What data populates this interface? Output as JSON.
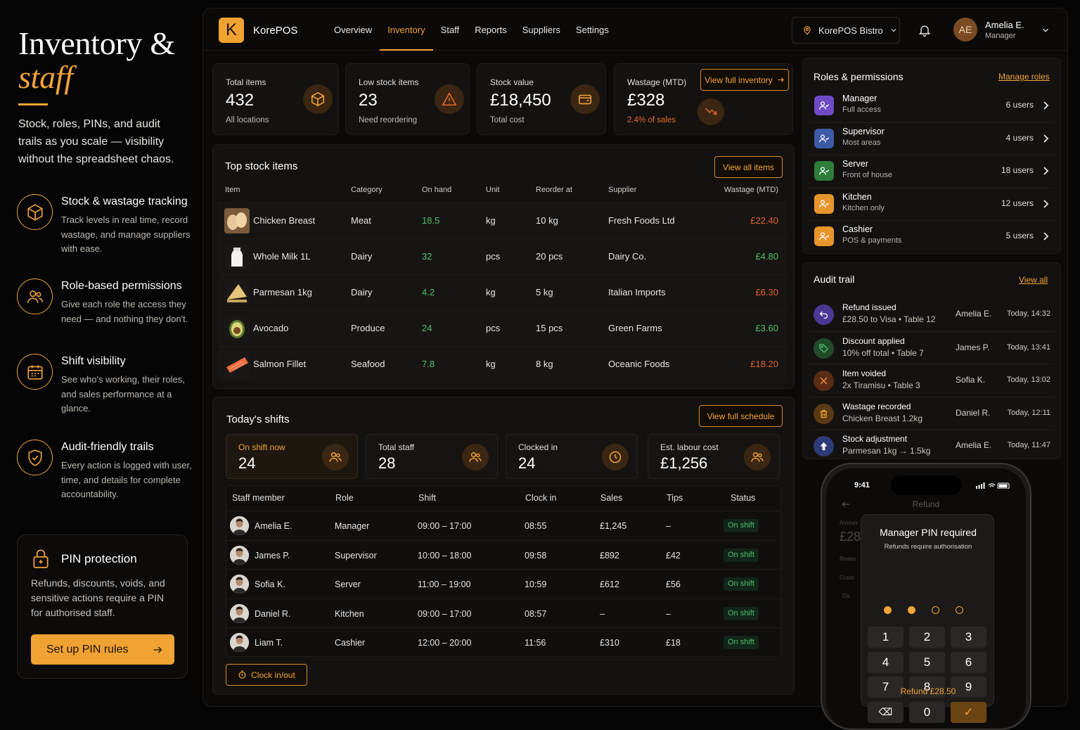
{
  "hero": {
    "title_line1": "Inventory &",
    "title_line2": "staff",
    "subtitle": "Stock, roles, PINs, and audit trails as you scale — visibility without the spreadsheet chaos."
  },
  "features": [
    {
      "icon": "cube-icon",
      "title": "Stock & wastage tracking",
      "desc": "Track levels in real time, record wastage, and manage suppliers with ease."
    },
    {
      "icon": "users-icon",
      "title": "Role-based permissions",
      "desc": "Give each role the access they need — and nothing they don't."
    },
    {
      "icon": "calendar-icon",
      "title": "Shift visibility",
      "desc": "See who's working, their roles, and sales performance at a glance."
    },
    {
      "icon": "shield-check-icon",
      "title": "Audit-friendly trails",
      "desc": "Every action is logged with user, time, and details for complete accountability."
    }
  ],
  "pin_card": {
    "icon": "lock-icon",
    "title": "PIN protection",
    "desc": "Refunds, discounts, voids, and sensitive actions require a PIN for authorised staff.",
    "button": "Set up PIN rules"
  },
  "topbar": {
    "logo_letter": "K",
    "brand": "KorePOS",
    "nav": [
      "Overview",
      "Inventory",
      "Staff",
      "Reports",
      "Suppliers",
      "Settings"
    ],
    "active_nav": "Inventory",
    "location": "KorePOS Bistro",
    "user_initials": "AE",
    "user_name": "Amelia E.",
    "user_role": "Manager"
  },
  "kpis": [
    {
      "label": "Total items",
      "value": "432",
      "sub": "All locations",
      "icon": "cube-icon"
    },
    {
      "label": "Low stock items",
      "value": "23",
      "sub": "Need reordering",
      "icon": "warning-icon"
    },
    {
      "label": "Stock value",
      "value": "£18,450",
      "sub": "Total cost",
      "icon": "wallet-icon"
    },
    {
      "label": "Wastage (MTD)",
      "value": "£328",
      "sub": "2.4% of sales",
      "icon": "trend-down-icon"
    }
  ],
  "view_inventory": "View full inventory",
  "stock": {
    "title": "Top stock items",
    "view_all": "View all items",
    "headers": [
      "Item",
      "Category",
      "On hand",
      "Unit",
      "Reorder at",
      "Supplier",
      "Wastage (MTD)"
    ],
    "rows": [
      {
        "item": "Chicken Breast",
        "category": "Meat",
        "on_hand": "18.5",
        "unit": "kg",
        "reorder": "10 kg",
        "supplier": "Fresh Foods Ltd",
        "wastage": "£22.40",
        "wastage_color": "#e2602f",
        "thumb": "chicken-thumbnail"
      },
      {
        "item": "Whole Milk 1L",
        "category": "Dairy",
        "on_hand": "32",
        "unit": "pcs",
        "reorder": "20 pcs",
        "supplier": "Dairy Co.",
        "wastage": "£4.80",
        "wastage_color": "#4fbf69",
        "thumb": "milk-thumbnail"
      },
      {
        "item": "Parmesan 1kg",
        "category": "Dairy",
        "on_hand": "4.2",
        "unit": "kg",
        "reorder": "5 kg",
        "supplier": "Italian Imports",
        "wastage": "£6.30",
        "wastage_color": "#e2602f",
        "thumb": "parmesan-thumbnail"
      },
      {
        "item": "Avocado",
        "category": "Produce",
        "on_hand": "24",
        "unit": "pcs",
        "reorder": "15 pcs",
        "supplier": "Green Farms",
        "wastage": "£3.60",
        "wastage_color": "#4fbf69",
        "thumb": "avocado-thumbnail"
      },
      {
        "item": "Salmon Fillet",
        "category": "Seafood",
        "on_hand": "7.8",
        "unit": "kg",
        "reorder": "8 kg",
        "supplier": "Oceanic Foods",
        "wastage": "£18.20",
        "wastage_color": "#e2602f",
        "thumb": "salmon-thumbnail"
      }
    ]
  },
  "shifts": {
    "title": "Today's shifts",
    "view_schedule": "View full schedule",
    "kpis": [
      {
        "label": "On shift now",
        "value": "24",
        "icon": "users-icon"
      },
      {
        "label": "Total staff",
        "value": "28",
        "icon": "users-icon"
      },
      {
        "label": "Clocked in",
        "value": "24",
        "icon": "clock-icon"
      },
      {
        "label": "Est. labour cost",
        "value": "£1,256",
        "icon": "users-icon"
      }
    ],
    "headers": [
      "Staff member",
      "Role",
      "Shift",
      "Clock in",
      "Sales",
      "Tips",
      "Status"
    ],
    "rows": [
      {
        "name": "Amelia E.",
        "role": "Manager",
        "shift": "09:00 – 17:00",
        "clock_in": "08:55",
        "sales": "£1,245",
        "tips": "–",
        "status": "On shift"
      },
      {
        "name": "James P.",
        "role": "Supervisor",
        "shift": "10:00 – 18:00",
        "clock_in": "09:58",
        "sales": "£892",
        "tips": "£42",
        "status": "On shift"
      },
      {
        "name": "Sofia K.",
        "role": "Server",
        "shift": "11:00 – 19:00",
        "clock_in": "10:59",
        "sales": "£612",
        "tips": "£56",
        "status": "On shift"
      },
      {
        "name": "Daniel R.",
        "role": "Kitchen",
        "shift": "09:00 – 17:00",
        "clock_in": "08:57",
        "sales": "–",
        "tips": "–",
        "status": "On shift"
      },
      {
        "name": "Liam T.",
        "role": "Cashier",
        "shift": "12:00 – 20:00",
        "clock_in": "11:56",
        "sales": "£310",
        "tips": "£18",
        "status": "On shift"
      }
    ],
    "clock_button": "Clock in/out"
  },
  "roles": {
    "title": "Roles & permissions",
    "manage": "Manage roles",
    "rows": [
      {
        "name": "Manager",
        "desc": "Full access",
        "count": "6 users",
        "color": "#6e4bc4"
      },
      {
        "name": "Supervisor",
        "desc": "Most areas",
        "count": "4 users",
        "color": "#3c5aa6"
      },
      {
        "name": "Server",
        "desc": "Front of house",
        "count": "18 users",
        "color": "#2e7d3c"
      },
      {
        "name": "Kitchen",
        "desc": "Kitchen only",
        "count": "12 users",
        "color": "#e8952c"
      },
      {
        "name": "Cashier",
        "desc": "POS & payments",
        "count": "5 users",
        "color": "#e8952c"
      }
    ]
  },
  "audit": {
    "title": "Audit trail",
    "view_all": "View all",
    "rows": [
      {
        "title": "Refund issued",
        "sub": "£28.50 to Visa • Table 12",
        "user": "Amelia E.",
        "time": "Today, 14:32",
        "icon": "refund-icon",
        "color": "#4b3795"
      },
      {
        "title": "Discount applied",
        "sub": "10% off total • Table 7",
        "user": "James P.",
        "time": "Today, 13:41",
        "icon": "tag-icon",
        "color": "#214a2a"
      },
      {
        "title": "Item voided",
        "sub": "2x Tiramisu  • Table 3",
        "user": "Sofia K.",
        "time": "Today, 13:02",
        "icon": "x-icon",
        "color": "#5a2b15"
      },
      {
        "title": "Wastage recorded",
        "sub": "Chicken Breast 1.2kg",
        "user": "Daniel R.",
        "time": "Today, 12:11",
        "icon": "trash-icon",
        "color": "#5a3a14"
      },
      {
        "title": "Stock adjustment",
        "sub": "Parmesan 1kg → 1.5kg",
        "user": "Amelia E.",
        "time": "Today, 11:47",
        "icon": "arrow-up-icon",
        "color": "#2f3a78"
      }
    ]
  },
  "phone": {
    "time": "9:41",
    "screen_title": "Refund",
    "bg_amount_label": "Amoun",
    "bg_amount": "£28",
    "bg_reason": "Reaso",
    "bg_option1": "Custo",
    "bg_option2": "Da",
    "modal_title": "Manager PIN required",
    "modal_sub": "Refunds require authorisation",
    "keys": [
      "1",
      "2",
      "3",
      "4",
      "5",
      "6",
      "7",
      "8",
      "9",
      "⌫",
      "0",
      "✓"
    ],
    "pin_filled": 2,
    "pin_length": 4,
    "refund_label": "Refund £28.50"
  }
}
